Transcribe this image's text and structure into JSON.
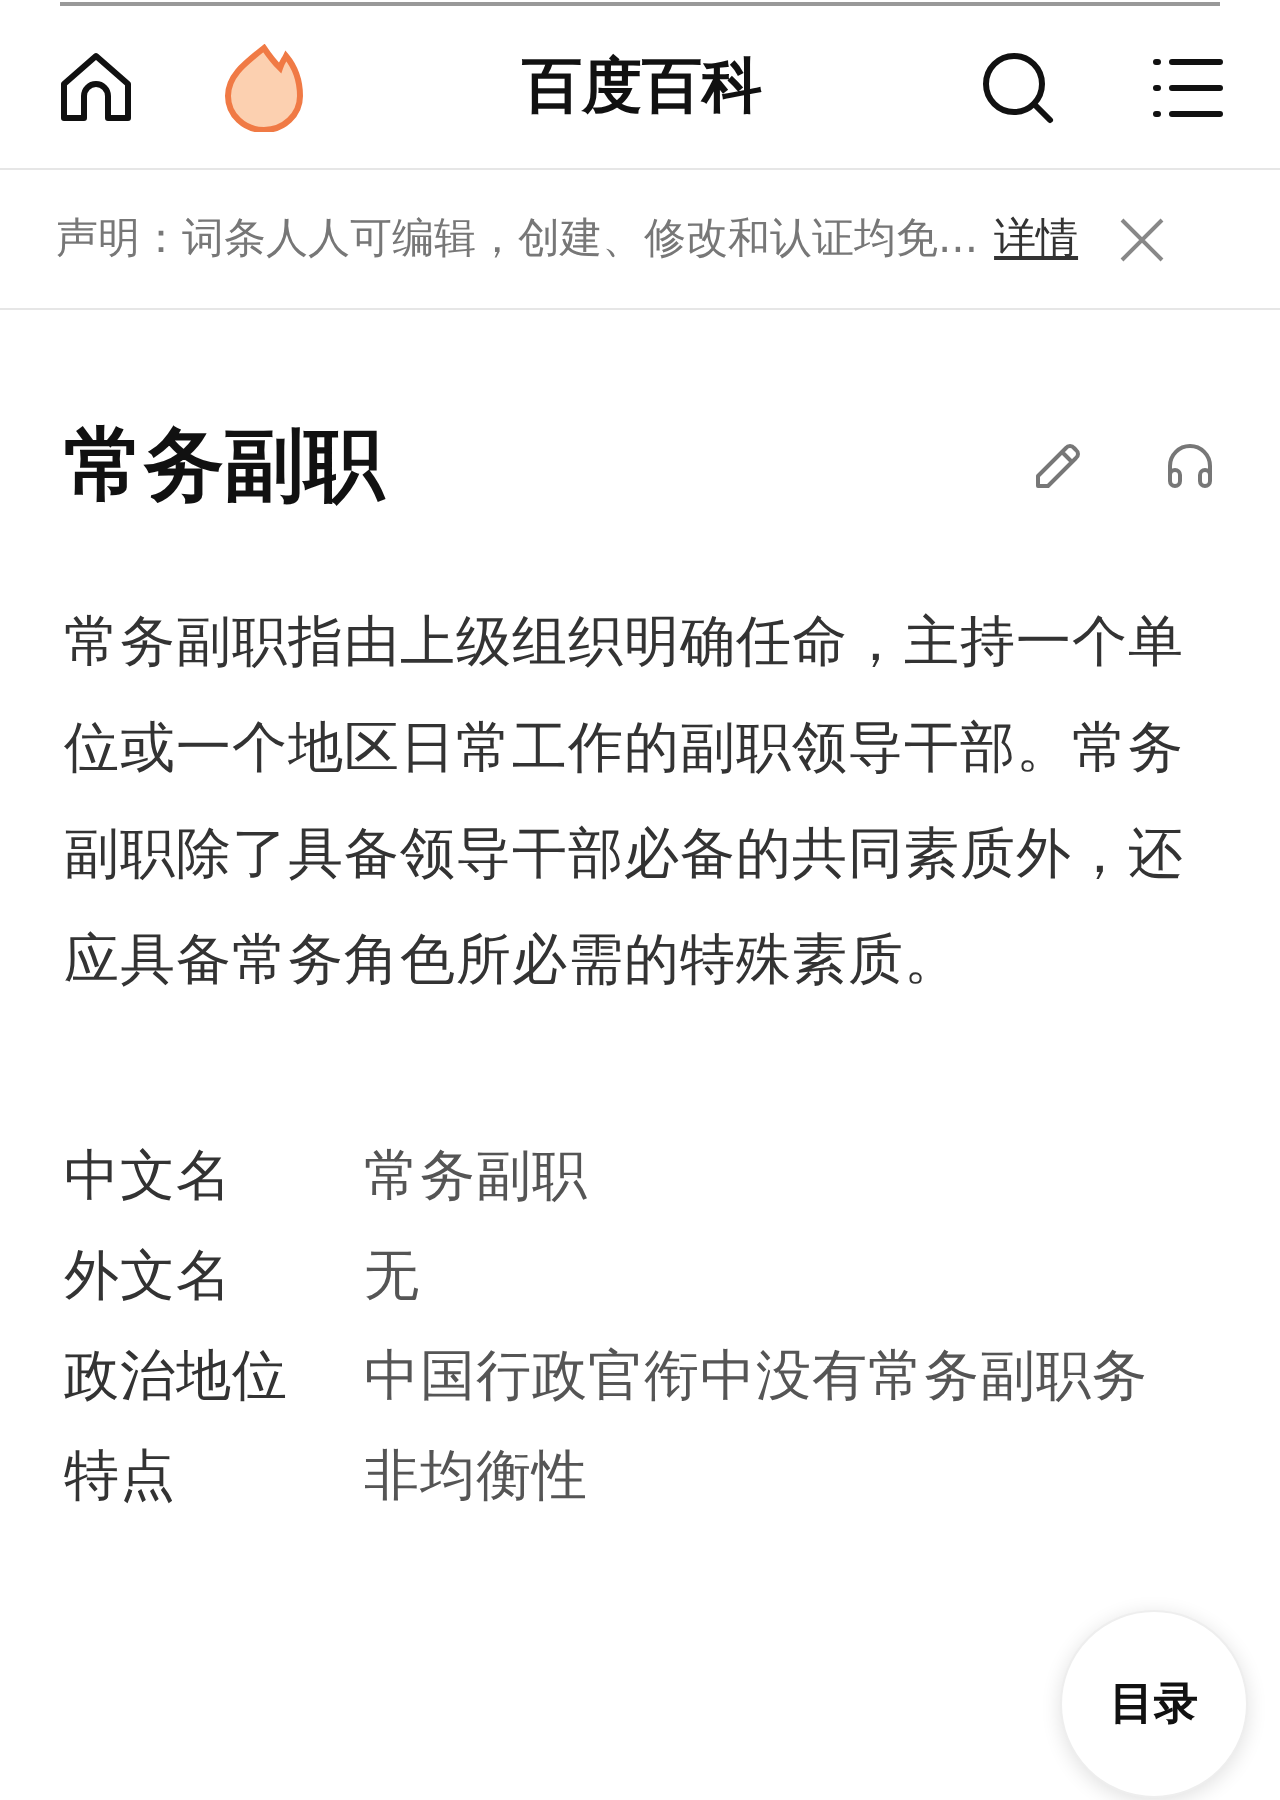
{
  "header": {
    "title": "百度百科"
  },
  "notice": {
    "text": "声明：词条人人可编辑，创建、修改和认证均免...",
    "link": "详情"
  },
  "article": {
    "title": "常务副职",
    "summary": "常务副职指由上级组织明确任命，主持一个单位或一个地区日常工作的副职领导干部。常务副职除了具备领导干部必备的共同素质外，还应具备常务角色所必需的特殊素质。"
  },
  "infobox": [
    {
      "label": "中文名",
      "value": "常务副职"
    },
    {
      "label": "外文名",
      "value": "无"
    },
    {
      "label": "政治地位",
      "value": "中国行政官衔中没有常务副职务"
    },
    {
      "label": "特点",
      "value": "非均衡性"
    }
  ],
  "toc_button": {
    "label": "目录"
  }
}
